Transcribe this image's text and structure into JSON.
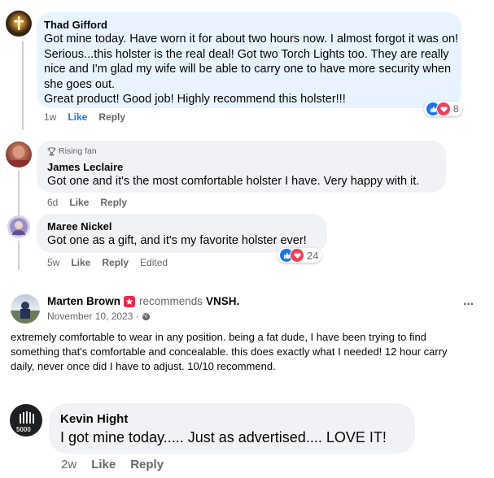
{
  "comments": [
    {
      "author": "Thad Gifford",
      "lines": [
        "Got mine today. Have worn it for about two hours now. I almost forgot it was on!",
        "Serious...this holster is the real deal! Got two Torch Lights too. They are really",
        "nice and I'm glad my wife will be able to carry one to have more security when",
        "she goes out.",
        "Great product! Good job! Highly recommend this holster!!!"
      ],
      "time": "1w",
      "like": "Like",
      "reply": "Reply",
      "reactions": "8"
    },
    {
      "badge": "Rising fan",
      "author": "James Leclaire",
      "text": "Got one and it's the most comfortable holster I have. Very happy with it.",
      "time": "6d",
      "like": "Like",
      "reply": "Reply"
    },
    {
      "author": "Maree Nickel",
      "text": "Got one as a gift, and it's my favorite holster ever!",
      "time": "5w",
      "like": "Like",
      "reply": "Reply",
      "edited": "Edited",
      "reactions": "24"
    }
  ],
  "review": {
    "author": "Marten Brown",
    "recommends": "recommends",
    "page": "VNSH.",
    "date": "November 10, 2023 ·",
    "more": "···",
    "lines": [
      "extremely comfortable to wear in any position.  being a fat dude, I have been trying to find",
      "something that's comfortable and concealable. this does exactly what I needed! 12 hour carry",
      "daily, never once did I have to adjust.  10/10 recommend."
    ]
  },
  "kevin": {
    "author": "Kevin Hight",
    "avatar_text": "5000",
    "text": "I got mine today..... Just as advertised.... LOVE IT!",
    "time": "2w",
    "like": "Like",
    "reply": "Reply"
  },
  "colors": {
    "highlight_bubble": "#e7f3ff",
    "bubble": "#f0f2f5",
    "like_blue": "#1877f2",
    "love_red": "#f33e58"
  }
}
